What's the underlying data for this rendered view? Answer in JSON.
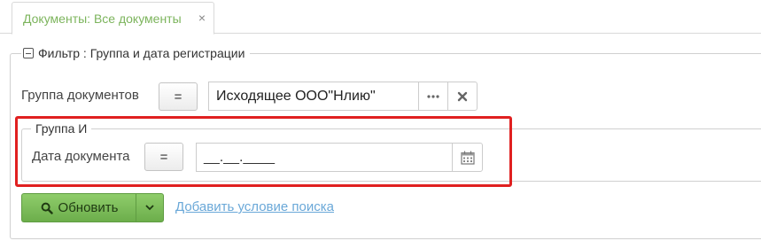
{
  "tabs": [
    {
      "label": "Документы: Все документы",
      "close_glyph": "×"
    }
  ],
  "filter": {
    "legend": "Фильтр : Группа и дата регистрации",
    "group_label": "Группа документов",
    "group_operator": "=",
    "group_value": "Исходящее ООО\"Нлию\"",
    "group_box": {
      "legend": "Группа И",
      "date_label": "Дата документа",
      "date_operator": "=",
      "date_value": "__.__.____"
    }
  },
  "actions": {
    "update_label": "Обновить",
    "add_condition_link": "Добавить условие поиска"
  },
  "icons": {
    "collapse": "minus-square-icon",
    "ellipsis": "ellipsis-icon",
    "clear": "close-icon",
    "calendar": "calendar-icon",
    "search": "search-icon",
    "caret": "chevron-down-icon"
  },
  "colors": {
    "tab_text": "#7cb45c",
    "primary_button": "#7dbd5a",
    "link": "#6aa8d8",
    "highlight": "#e02020"
  }
}
